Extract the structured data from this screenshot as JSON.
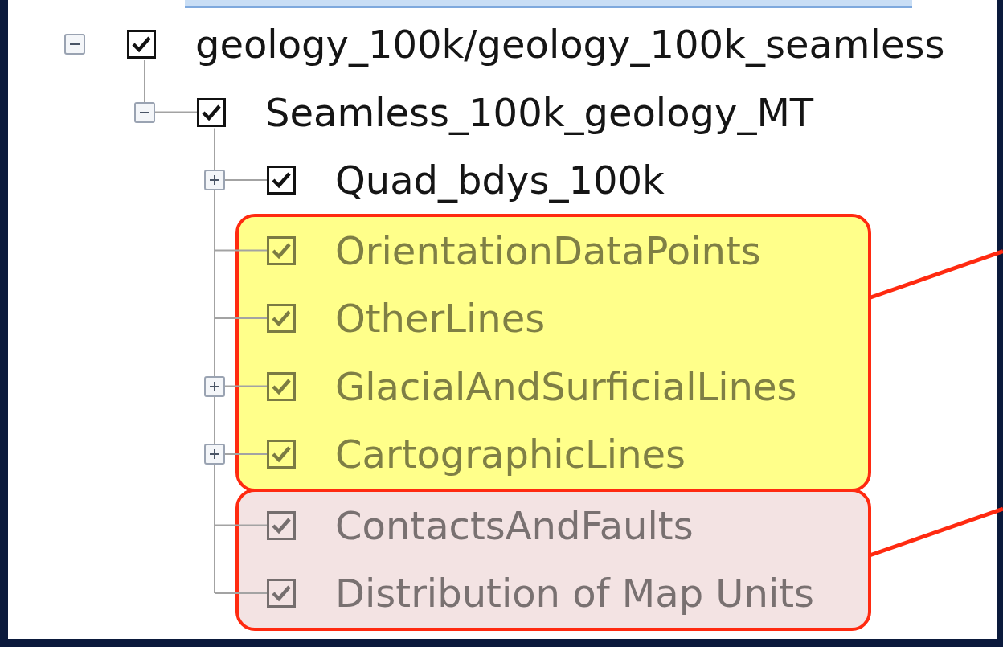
{
  "tree": [
    {
      "label": "geology_100k/geology_100k_seamless",
      "checked": true,
      "disabled": false,
      "expanded": true,
      "children": [
        {
          "label": "Seamless_100k_geology_MT",
          "checked": true,
          "disabled": false,
          "expanded": true,
          "children": [
            {
              "label": "Quad_bdys_100k",
              "checked": true,
              "disabled": false,
              "expanded": false
            },
            {
              "label": "OrientationDataPoints",
              "checked": true,
              "disabled": true,
              "color": "#ffff8a"
            },
            {
              "label": "OtherLines",
              "checked": true,
              "disabled": true,
              "color": "#ffff8a"
            },
            {
              "label": "GlacialAndSurficialLines",
              "checked": true,
              "disabled": true,
              "expanded": false,
              "color": "#ffff8a"
            },
            {
              "label": "CartographicLines",
              "checked": true,
              "disabled": true,
              "expanded": false,
              "color": "#ffff8a"
            },
            {
              "label": "ContactsAndFaults",
              "checked": true,
              "disabled": true,
              "color": "#f3e3e3"
            },
            {
              "label": "Distribution of Map Units",
              "checked": true,
              "disabled": true,
              "color": "#f3e3e3"
            }
          ]
        }
      ]
    }
  ]
}
